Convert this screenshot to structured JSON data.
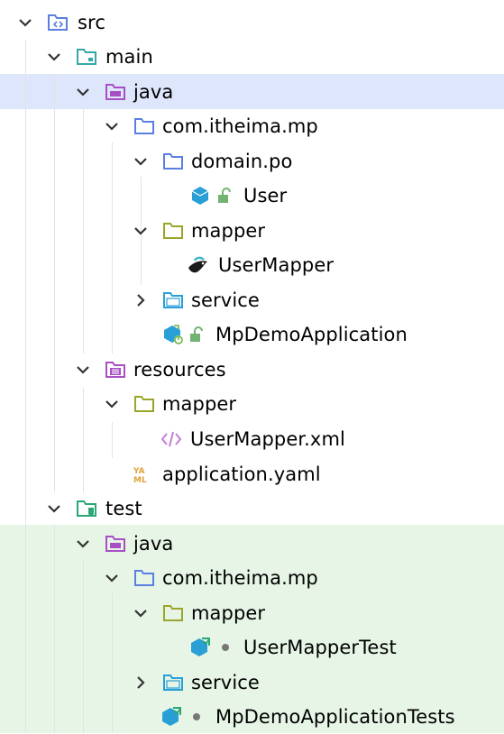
{
  "tree": {
    "src": {
      "label": "src"
    },
    "main": {
      "label": "main"
    },
    "main_java": {
      "label": "java"
    },
    "main_pkg": {
      "label": "com.itheima.mp"
    },
    "domain_po": {
      "label": "domain.po"
    },
    "user": {
      "label": "User"
    },
    "mapper_pkg": {
      "label": "mapper"
    },
    "user_mapper": {
      "label": "UserMapper"
    },
    "service_pkg": {
      "label": "service"
    },
    "mp_demo_app": {
      "label": "MpDemoApplication"
    },
    "resources": {
      "label": "resources"
    },
    "res_mapper": {
      "label": "mapper"
    },
    "user_mapper_xml": {
      "label": "UserMapper.xml"
    },
    "application_yaml": {
      "label": "application.yaml"
    },
    "test": {
      "label": "test"
    },
    "test_java": {
      "label": "java"
    },
    "test_pkg": {
      "label": "com.itheima.mp"
    },
    "test_mapper": {
      "label": "mapper"
    },
    "user_mapper_test": {
      "label": "UserMapperTest"
    },
    "test_service": {
      "label": "service"
    },
    "mp_demo_app_tests": {
      "label": "MpDemoApplicationTests"
    }
  },
  "colors": {
    "selected_row": "#dde6fb",
    "test_area": "#e6f5e6",
    "folder_blue": "#5b7fe0",
    "folder_teal": "#36a7a7",
    "folder_purple": "#a84fc4",
    "folder_olive": "#9ba52a",
    "folder_green": "#2aa775",
    "class_blue": "#2a9fd6",
    "lock_green": "#71b371"
  }
}
